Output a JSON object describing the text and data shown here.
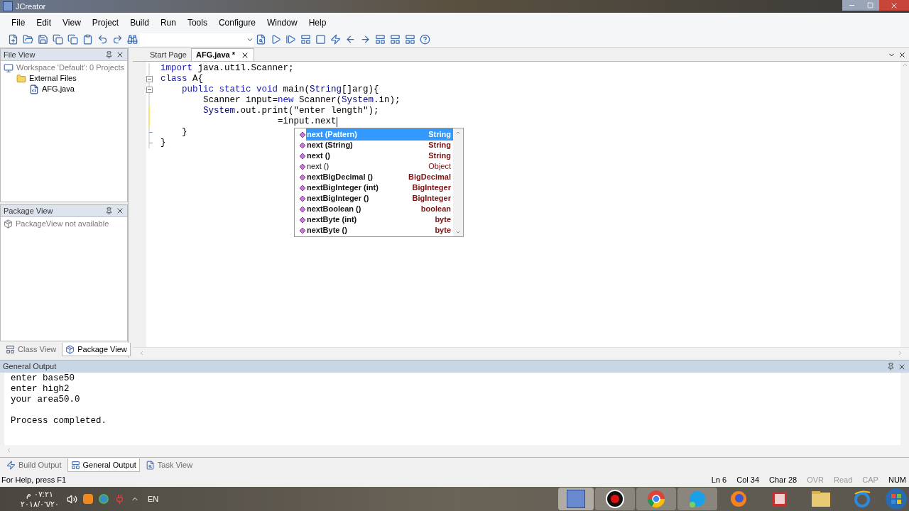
{
  "window": {
    "title": "JCreator"
  },
  "menu": [
    "File",
    "Edit",
    "View",
    "Project",
    "Build",
    "Run",
    "Tools",
    "Configure",
    "Window",
    "Help"
  ],
  "file_view": {
    "title": "File View",
    "tree": [
      {
        "label": "Workspace 'Default': 0 Projects",
        "disabled": true,
        "kind": "workspace",
        "children": [
          {
            "label": "External Files",
            "disabled": false,
            "kind": "folder",
            "children": [
              {
                "label": "AFG.java",
                "disabled": false,
                "kind": "file"
              }
            ]
          }
        ]
      }
    ]
  },
  "package_view": {
    "title": "Package View",
    "items": [
      {
        "label": "PackageView not available",
        "disabled": true
      }
    ]
  },
  "left_tabs": [
    {
      "label": "Class View",
      "selected": false
    },
    {
      "label": "Package View",
      "selected": true
    }
  ],
  "editor": {
    "tabs": [
      {
        "label": "Start Page",
        "selected": false,
        "closable": false
      },
      {
        "label": "AFG.java *",
        "selected": true,
        "closable": true
      }
    ],
    "lines": [
      {
        "changed": false,
        "segments": [
          {
            "kind": "keyword",
            "text": "import"
          },
          {
            "kind": "plain",
            "text": " java.util.Scanner;"
          }
        ]
      },
      {
        "fold_start": true,
        "changed": false,
        "segments": [
          {
            "kind": "keyword",
            "text": "class"
          },
          {
            "kind": "plain",
            "text": " A{"
          }
        ]
      },
      {
        "fold_start": true,
        "changed": false,
        "segments": [
          {
            "kind": "keyword",
            "text": "    public static void"
          },
          {
            "kind": "plain",
            "text": " main("
          },
          {
            "kind": "type",
            "text": "String"
          },
          {
            "kind": "plain",
            "text": "[]arg){"
          }
        ]
      },
      {
        "changed": false,
        "segments": [
          {
            "kind": "plain",
            "text": "        Scanner input="
          },
          {
            "kind": "keyword",
            "text": "new"
          },
          {
            "kind": "plain",
            "text": " Scanner("
          },
          {
            "kind": "type",
            "text": "System"
          },
          {
            "kind": "plain",
            "text": ".in);"
          }
        ]
      },
      {
        "changed": true,
        "segments": [
          {
            "kind": "type",
            "text": "        System"
          },
          {
            "kind": "plain",
            "text": ".out.print(\"enter length\");"
          }
        ]
      },
      {
        "changed": true,
        "caret": true,
        "segments": [
          {
            "kind": "plain",
            "text": "                      =input.next"
          }
        ]
      },
      {
        "fold_end": true,
        "changed": false,
        "segments": [
          {
            "kind": "plain",
            "text": "    }"
          }
        ]
      },
      {
        "fold_end": true,
        "changed": false,
        "segments": [
          {
            "kind": "plain",
            "text": "}"
          }
        ]
      }
    ],
    "completion": {
      "items": [
        {
          "name": "next (Pattern)",
          "type": "String",
          "bold": true,
          "selected": true
        },
        {
          "name": "next (String)",
          "type": "String",
          "bold": true,
          "selected": false
        },
        {
          "name": "next ()",
          "type": "String",
          "bold": true,
          "selected": false
        },
        {
          "name": "next ()",
          "type": "Object",
          "bold": false,
          "selected": false
        },
        {
          "name": "nextBigDecimal ()",
          "type": "BigDecimal",
          "bold": true,
          "selected": false
        },
        {
          "name": "nextBigInteger (int)",
          "type": "BigInteger",
          "bold": true,
          "selected": false
        },
        {
          "name": "nextBigInteger ()",
          "type": "BigInteger",
          "bold": true,
          "selected": false
        },
        {
          "name": "nextBoolean ()",
          "type": "boolean",
          "bold": true,
          "selected": false
        },
        {
          "name": "nextByte (int)",
          "type": "byte",
          "bold": true,
          "selected": false
        },
        {
          "name": "nextByte ()",
          "type": "byte",
          "bold": true,
          "selected": false
        }
      ]
    }
  },
  "output": {
    "title": "General Output",
    "lines": [
      "enter base50",
      "enter high2",
      "your area50.0"
    ],
    "result": "Process completed."
  },
  "output_tabs": [
    {
      "label": "Build Output",
      "selected": false
    },
    {
      "label": "General Output",
      "selected": true
    },
    {
      "label": "Task View",
      "selected": false
    }
  ],
  "status_bar": {
    "help": "For Help, press F1",
    "indicators": [
      {
        "text": "Ln 6",
        "disabled": false
      },
      {
        "text": "Col 34",
        "disabled": false
      },
      {
        "text": "Char 28",
        "disabled": false
      },
      {
        "text": "OVR",
        "disabled": true
      },
      {
        "text": "Read",
        "disabled": true
      },
      {
        "text": "CAP",
        "disabled": true
      },
      {
        "text": "NUM",
        "disabled": false
      }
    ]
  },
  "taskbar": {
    "time": "٠٧:٢١ م",
    "date": "٢٠١٨/٠٦/٢٠",
    "language": "EN"
  }
}
